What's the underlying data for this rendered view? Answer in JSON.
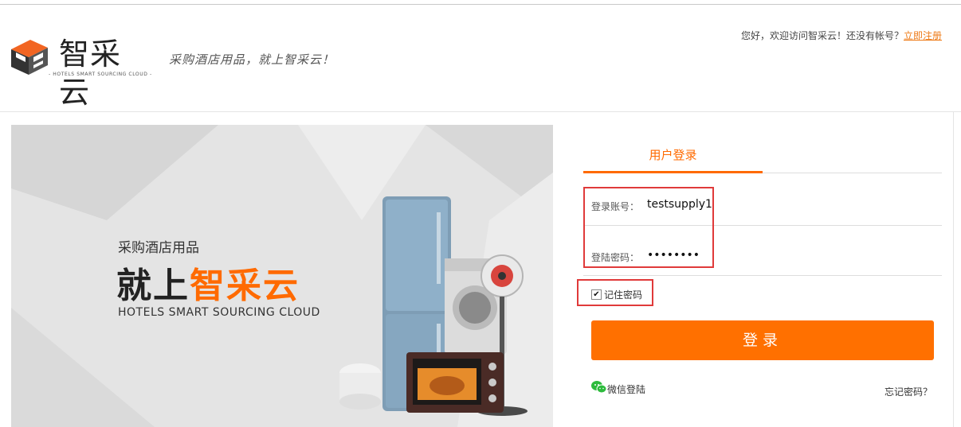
{
  "header": {
    "brand_name": "智采云",
    "brand_sub": "- HOTELS SMART SOURCING CLOUD -",
    "slogan": "采购酒店用品，就上智采云！",
    "welcome_text": "您好，欢迎访问智采云！还没有帐号？",
    "register_link": "立即注册"
  },
  "banner": {
    "subtitle": "采购酒店用品",
    "title_prefix": "就上",
    "title_brand": "智采云",
    "english": "HOTELS SMART SOURCING CLOUD"
  },
  "login": {
    "tab_label": "用户登录",
    "account_label": "登录账号：",
    "account_value": "testsupply1",
    "password_label": "登陆密码：",
    "password_value": "••••••••",
    "remember_checked": true,
    "remember_label": "记住密码",
    "submit_label": "登录",
    "wechat_label": "微信登陆",
    "forgot_label": "忘记密码？"
  },
  "colors": {
    "accent": "#ff7000",
    "highlight_box": "#e03a3a",
    "wechat_green": "#2dbb3d"
  }
}
